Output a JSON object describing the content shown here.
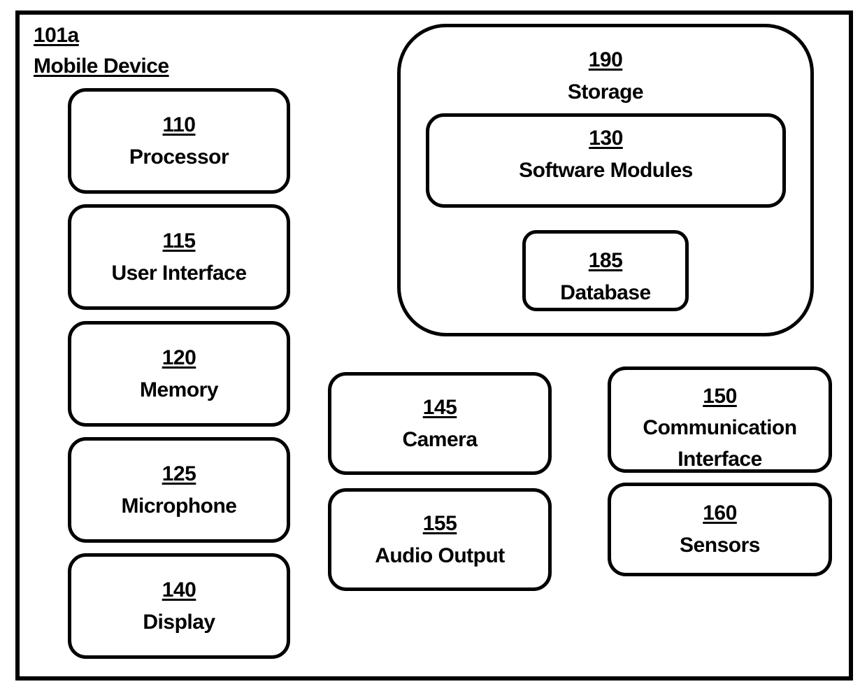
{
  "device": {
    "number": "101a",
    "label": "Mobile Device"
  },
  "components": {
    "processor": {
      "number": "110",
      "label": "Processor"
    },
    "user_interface": {
      "number": "115",
      "label": "User Interface"
    },
    "memory": {
      "number": "120",
      "label": "Memory"
    },
    "microphone": {
      "number": "125",
      "label": "Microphone"
    },
    "display": {
      "number": "140",
      "label": "Display"
    },
    "camera": {
      "number": "145",
      "label": "Camera"
    },
    "audio_output": {
      "number": "155",
      "label": "Audio Output"
    },
    "communication_interface": {
      "number": "150",
      "label": "Communication Interface"
    },
    "sensors": {
      "number": "160",
      "label": "Sensors"
    },
    "storage": {
      "number": "190",
      "label": "Storage"
    },
    "software_modules": {
      "number": "130",
      "label": "Software Modules"
    },
    "database": {
      "number": "185",
      "label": "Database"
    }
  }
}
